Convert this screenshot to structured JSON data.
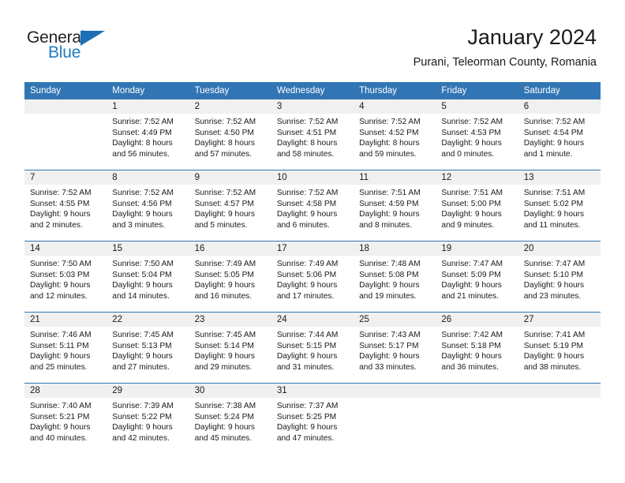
{
  "brand": {
    "name_part1": "General",
    "name_part2": "Blue",
    "triangle_icon": "triangle-icon",
    "colors": {
      "dark": "#231f20",
      "blue": "#1f7bc1",
      "header_blue": "#3175b4",
      "row_band": "#f0f0f0"
    }
  },
  "header": {
    "title": "January 2024",
    "subtitle": "Purani, Teleorman County, Romania"
  },
  "calendar": {
    "weekdays": [
      "Sunday",
      "Monday",
      "Tuesday",
      "Wednesday",
      "Thursday",
      "Friday",
      "Saturday"
    ],
    "weeks": [
      {
        "days": [
          {
            "num": "",
            "lines": []
          },
          {
            "num": "1",
            "lines": [
              "Sunrise: 7:52 AM",
              "Sunset: 4:49 PM",
              "Daylight: 8 hours",
              "and 56 minutes."
            ]
          },
          {
            "num": "2",
            "lines": [
              "Sunrise: 7:52 AM",
              "Sunset: 4:50 PM",
              "Daylight: 8 hours",
              "and 57 minutes."
            ]
          },
          {
            "num": "3",
            "lines": [
              "Sunrise: 7:52 AM",
              "Sunset: 4:51 PM",
              "Daylight: 8 hours",
              "and 58 minutes."
            ]
          },
          {
            "num": "4",
            "lines": [
              "Sunrise: 7:52 AM",
              "Sunset: 4:52 PM",
              "Daylight: 8 hours",
              "and 59 minutes."
            ]
          },
          {
            "num": "5",
            "lines": [
              "Sunrise: 7:52 AM",
              "Sunset: 4:53 PM",
              "Daylight: 9 hours",
              "and 0 minutes."
            ]
          },
          {
            "num": "6",
            "lines": [
              "Sunrise: 7:52 AM",
              "Sunset: 4:54 PM",
              "Daylight: 9 hours",
              "and 1 minute."
            ]
          }
        ]
      },
      {
        "days": [
          {
            "num": "7",
            "lines": [
              "Sunrise: 7:52 AM",
              "Sunset: 4:55 PM",
              "Daylight: 9 hours",
              "and 2 minutes."
            ]
          },
          {
            "num": "8",
            "lines": [
              "Sunrise: 7:52 AM",
              "Sunset: 4:56 PM",
              "Daylight: 9 hours",
              "and 3 minutes."
            ]
          },
          {
            "num": "9",
            "lines": [
              "Sunrise: 7:52 AM",
              "Sunset: 4:57 PM",
              "Daylight: 9 hours",
              "and 5 minutes."
            ]
          },
          {
            "num": "10",
            "lines": [
              "Sunrise: 7:52 AM",
              "Sunset: 4:58 PM",
              "Daylight: 9 hours",
              "and 6 minutes."
            ]
          },
          {
            "num": "11",
            "lines": [
              "Sunrise: 7:51 AM",
              "Sunset: 4:59 PM",
              "Daylight: 9 hours",
              "and 8 minutes."
            ]
          },
          {
            "num": "12",
            "lines": [
              "Sunrise: 7:51 AM",
              "Sunset: 5:00 PM",
              "Daylight: 9 hours",
              "and 9 minutes."
            ]
          },
          {
            "num": "13",
            "lines": [
              "Sunrise: 7:51 AM",
              "Sunset: 5:02 PM",
              "Daylight: 9 hours",
              "and 11 minutes."
            ]
          }
        ]
      },
      {
        "days": [
          {
            "num": "14",
            "lines": [
              "Sunrise: 7:50 AM",
              "Sunset: 5:03 PM",
              "Daylight: 9 hours",
              "and 12 minutes."
            ]
          },
          {
            "num": "15",
            "lines": [
              "Sunrise: 7:50 AM",
              "Sunset: 5:04 PM",
              "Daylight: 9 hours",
              "and 14 minutes."
            ]
          },
          {
            "num": "16",
            "lines": [
              "Sunrise: 7:49 AM",
              "Sunset: 5:05 PM",
              "Daylight: 9 hours",
              "and 16 minutes."
            ]
          },
          {
            "num": "17",
            "lines": [
              "Sunrise: 7:49 AM",
              "Sunset: 5:06 PM",
              "Daylight: 9 hours",
              "and 17 minutes."
            ]
          },
          {
            "num": "18",
            "lines": [
              "Sunrise: 7:48 AM",
              "Sunset: 5:08 PM",
              "Daylight: 9 hours",
              "and 19 minutes."
            ]
          },
          {
            "num": "19",
            "lines": [
              "Sunrise: 7:47 AM",
              "Sunset: 5:09 PM",
              "Daylight: 9 hours",
              "and 21 minutes."
            ]
          },
          {
            "num": "20",
            "lines": [
              "Sunrise: 7:47 AM",
              "Sunset: 5:10 PM",
              "Daylight: 9 hours",
              "and 23 minutes."
            ]
          }
        ]
      },
      {
        "days": [
          {
            "num": "21",
            "lines": [
              "Sunrise: 7:46 AM",
              "Sunset: 5:11 PM",
              "Daylight: 9 hours",
              "and 25 minutes."
            ]
          },
          {
            "num": "22",
            "lines": [
              "Sunrise: 7:45 AM",
              "Sunset: 5:13 PM",
              "Daylight: 9 hours",
              "and 27 minutes."
            ]
          },
          {
            "num": "23",
            "lines": [
              "Sunrise: 7:45 AM",
              "Sunset: 5:14 PM",
              "Daylight: 9 hours",
              "and 29 minutes."
            ]
          },
          {
            "num": "24",
            "lines": [
              "Sunrise: 7:44 AM",
              "Sunset: 5:15 PM",
              "Daylight: 9 hours",
              "and 31 minutes."
            ]
          },
          {
            "num": "25",
            "lines": [
              "Sunrise: 7:43 AM",
              "Sunset: 5:17 PM",
              "Daylight: 9 hours",
              "and 33 minutes."
            ]
          },
          {
            "num": "26",
            "lines": [
              "Sunrise: 7:42 AM",
              "Sunset: 5:18 PM",
              "Daylight: 9 hours",
              "and 36 minutes."
            ]
          },
          {
            "num": "27",
            "lines": [
              "Sunrise: 7:41 AM",
              "Sunset: 5:19 PM",
              "Daylight: 9 hours",
              "and 38 minutes."
            ]
          }
        ]
      },
      {
        "days": [
          {
            "num": "28",
            "lines": [
              "Sunrise: 7:40 AM",
              "Sunset: 5:21 PM",
              "Daylight: 9 hours",
              "and 40 minutes."
            ]
          },
          {
            "num": "29",
            "lines": [
              "Sunrise: 7:39 AM",
              "Sunset: 5:22 PM",
              "Daylight: 9 hours",
              "and 42 minutes."
            ]
          },
          {
            "num": "30",
            "lines": [
              "Sunrise: 7:38 AM",
              "Sunset: 5:24 PM",
              "Daylight: 9 hours",
              "and 45 minutes."
            ]
          },
          {
            "num": "31",
            "lines": [
              "Sunrise: 7:37 AM",
              "Sunset: 5:25 PM",
              "Daylight: 9 hours",
              "and 47 minutes."
            ]
          },
          {
            "num": "",
            "lines": []
          },
          {
            "num": "",
            "lines": []
          },
          {
            "num": "",
            "lines": []
          }
        ]
      }
    ]
  }
}
